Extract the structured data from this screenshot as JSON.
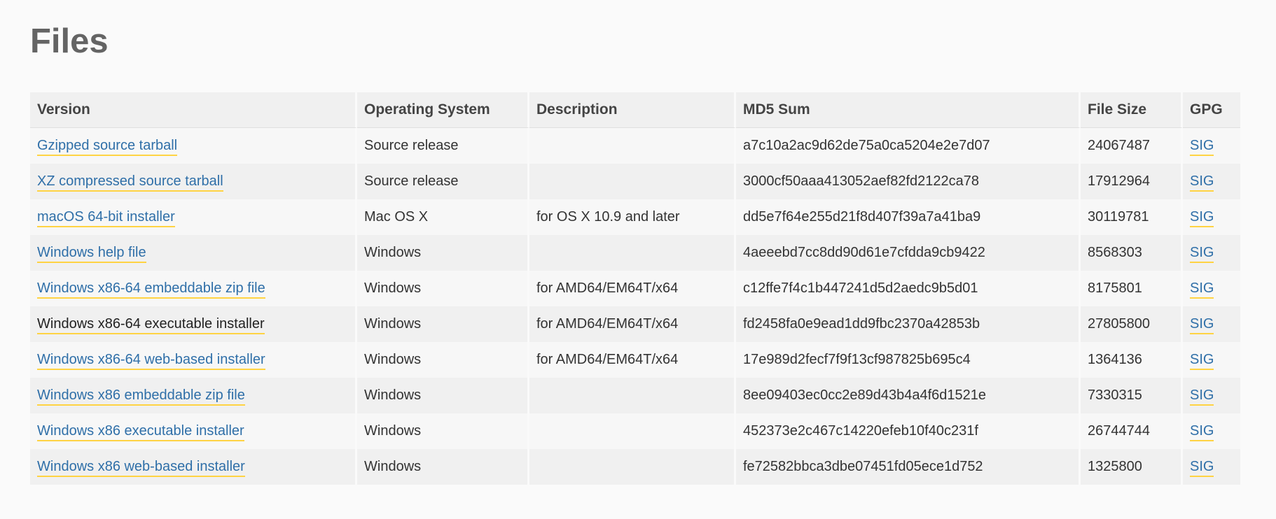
{
  "page": {
    "title": "Files"
  },
  "table": {
    "headers": {
      "version": "Version",
      "os": "Operating System",
      "description": "Description",
      "md5": "MD5 Sum",
      "size": "File Size",
      "gpg": "GPG"
    },
    "rows": [
      {
        "version": "Gzipped source tarball",
        "os": "Source release",
        "description": "",
        "md5": "a7c10a2ac9d62de75a0ca5204e2e7d07",
        "size": "24067487",
        "gpg": "SIG"
      },
      {
        "version": "XZ compressed source tarball",
        "os": "Source release",
        "description": "",
        "md5": "3000cf50aaa413052aef82fd2122ca78",
        "size": "17912964",
        "gpg": "SIG"
      },
      {
        "version": "macOS 64-bit installer",
        "os": "Mac OS X",
        "description": "for OS X 10.9 and later",
        "md5": "dd5e7f64e255d21f8d407f39a7a41ba9",
        "size": "30119781",
        "gpg": "SIG"
      },
      {
        "version": "Windows help file",
        "os": "Windows",
        "description": "",
        "md5": "4aeeebd7cc8dd90d61e7cfdda9cb9422",
        "size": "8568303",
        "gpg": "SIG"
      },
      {
        "version": "Windows x86-64 embeddable zip file",
        "os": "Windows",
        "description": "for AMD64/EM64T/x64",
        "md5": "c12ffe7f4c1b447241d5d2aedc9b5d01",
        "size": "8175801",
        "gpg": "SIG"
      },
      {
        "version": "Windows x86-64 executable installer",
        "os": "Windows",
        "description": "for AMD64/EM64T/x64",
        "md5": "fd2458fa0e9ead1dd9fbc2370a42853b",
        "size": "27805800",
        "gpg": "SIG"
      },
      {
        "version": "Windows x86-64 web-based installer",
        "os": "Windows",
        "description": "for AMD64/EM64T/x64",
        "md5": "17e989d2fecf7f9f13cf987825b695c4",
        "size": "1364136",
        "gpg": "SIG"
      },
      {
        "version": "Windows x86 embeddable zip file",
        "os": "Windows",
        "description": "",
        "md5": "8ee09403ec0cc2e89d43b4a4f6d1521e",
        "size": "7330315",
        "gpg": "SIG"
      },
      {
        "version": "Windows x86 executable installer",
        "os": "Windows",
        "description": "",
        "md5": "452373e2c467c14220efeb10f40c231f",
        "size": "26744744",
        "gpg": "SIG"
      },
      {
        "version": "Windows x86 web-based installer",
        "os": "Windows",
        "description": "",
        "md5": "fe72582bbca3dbe07451fd05ece1d752",
        "size": "1325800",
        "gpg": "SIG"
      }
    ]
  },
  "colors": {
    "link": "#2f6fa8",
    "link_underline": "#ffd343",
    "title": "#646464"
  }
}
